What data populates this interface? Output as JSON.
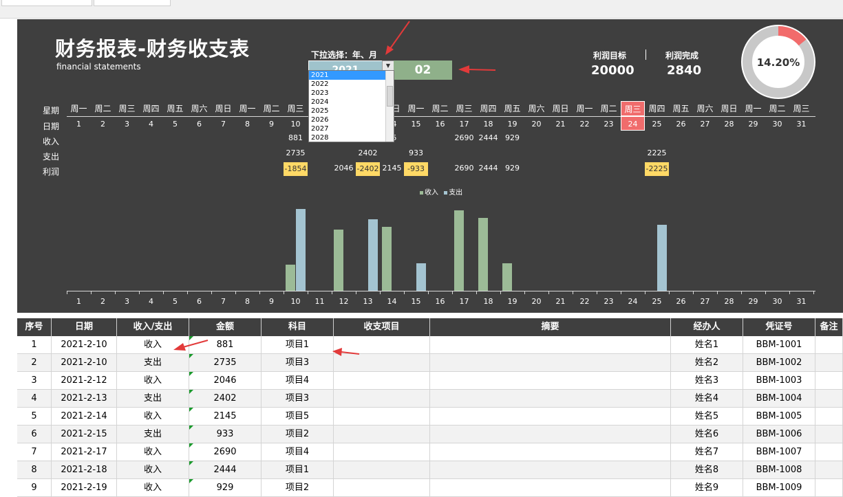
{
  "header": {
    "title": "财务报表-财务收支表",
    "subtitle": "financial statements"
  },
  "selector": {
    "label": "下拉选择：年、月",
    "year": "2021",
    "month": "02",
    "year_options": [
      "2021",
      "2022",
      "2023",
      "2024",
      "2025",
      "2026",
      "2027",
      "2028"
    ]
  },
  "kpi": {
    "target_label": "利润目标",
    "target_value": "20000",
    "done_label": "利润完成",
    "done_value": "2840",
    "percent": "14.20%",
    "percent_value": 0.142
  },
  "calendar": {
    "row_labels": [
      "星期",
      "日期",
      "收入",
      "支出",
      "利润"
    ],
    "weekdays": [
      "周一",
      "周二",
      "周三",
      "周四",
      "周五",
      "周六",
      "周日",
      "周一",
      "周二",
      "周三",
      "周四",
      "周五",
      "周六",
      "周日",
      "周一",
      "周二",
      "周三",
      "周四",
      "周五",
      "周六",
      "周日",
      "周一",
      "周二",
      "周三",
      "周四",
      "周五",
      "周六",
      "周日",
      "周一",
      "周二",
      "周三"
    ],
    "dates": [
      "1",
      "2",
      "3",
      "4",
      "5",
      "6",
      "7",
      "8",
      "9",
      "10",
      "11",
      "12",
      "13",
      "14",
      "15",
      "16",
      "17",
      "18",
      "19",
      "20",
      "21",
      "22",
      "23",
      "24",
      "25",
      "26",
      "27",
      "28",
      "29",
      "30",
      "31"
    ],
    "highlight_index": 23,
    "income": [
      "",
      "",
      "",
      "",
      "",
      "",
      "",
      "",
      "",
      "881",
      "",
      "",
      "",
      "45",
      "",
      "",
      "2690",
      "2444",
      "929",
      "",
      "",
      "",
      "",
      "",
      "",
      "",
      "",
      "",
      "",
      "",
      ""
    ],
    "expense": [
      "",
      "",
      "",
      "",
      "",
      "",
      "",
      "",
      "",
      "2735",
      "",
      "",
      "2402",
      "",
      "933",
      "",
      "",
      "",
      "",
      "",
      "",
      "",
      "",
      "",
      "2225",
      "",
      "",
      "",
      "",
      "",
      ""
    ],
    "profit": [
      "",
      "",
      "",
      "",
      "",
      "",
      "",
      "",
      "",
      "-1854",
      "",
      "2046",
      "-2402",
      "2145",
      "-933",
      "",
      "2690",
      "2444",
      "929",
      "",
      "",
      "",
      "",
      "",
      "-2225",
      "",
      "",
      "",
      "",
      "",
      ""
    ]
  },
  "chart_data": {
    "type": "bar",
    "legend": [
      "收入",
      "支出"
    ],
    "legend_position": "top",
    "categories": [
      "1",
      "2",
      "3",
      "4",
      "5",
      "6",
      "7",
      "8",
      "9",
      "10",
      "11",
      "12",
      "13",
      "14",
      "15",
      "16",
      "17",
      "18",
      "19",
      "20",
      "21",
      "22",
      "23",
      "24",
      "25",
      "26",
      "27",
      "28",
      "29",
      "30",
      "31"
    ],
    "series": [
      {
        "name": "收入",
        "color": "#9cbb97",
        "values": [
          0,
          0,
          0,
          0,
          0,
          0,
          0,
          0,
          0,
          881,
          0,
          2046,
          0,
          2145,
          0,
          0,
          2690,
          2444,
          929,
          0,
          0,
          0,
          0,
          0,
          0,
          0,
          0,
          0,
          0,
          0,
          0
        ]
      },
      {
        "name": "支出",
        "color": "#a4c4d1",
        "values": [
          0,
          0,
          0,
          0,
          0,
          0,
          0,
          0,
          0,
          2735,
          0,
          0,
          2402,
          0,
          933,
          0,
          0,
          0,
          0,
          0,
          0,
          0,
          0,
          0,
          2225,
          0,
          0,
          0,
          0,
          0,
          0
        ]
      }
    ],
    "ylim": [
      0,
      3000
    ]
  },
  "table": {
    "headers": [
      "序号",
      "日期",
      "收入/支出",
      "金额",
      "科目",
      "收支项目",
      "摘要",
      "经办人",
      "凭证号",
      "备注"
    ],
    "rows": [
      [
        "1",
        "2021-2-10",
        "收入",
        "881",
        "项目1",
        "",
        "",
        "姓名1",
        "BBM-1001",
        ""
      ],
      [
        "2",
        "2021-2-10",
        "支出",
        "2735",
        "项目3",
        "",
        "",
        "姓名2",
        "BBM-1002",
        ""
      ],
      [
        "3",
        "2021-2-12",
        "收入",
        "2046",
        "项目4",
        "",
        "",
        "姓名3",
        "BBM-1003",
        ""
      ],
      [
        "4",
        "2021-2-13",
        "支出",
        "2402",
        "项目3",
        "",
        "",
        "姓名4",
        "BBM-1004",
        ""
      ],
      [
        "5",
        "2021-2-14",
        "收入",
        "2145",
        "项目5",
        "",
        "",
        "姓名5",
        "BBM-1005",
        ""
      ],
      [
        "6",
        "2021-2-15",
        "支出",
        "933",
        "项目2",
        "",
        "",
        "姓名6",
        "BBM-1006",
        ""
      ],
      [
        "7",
        "2021-2-17",
        "收入",
        "2690",
        "项目4",
        "",
        "",
        "姓名7",
        "BBM-1007",
        ""
      ],
      [
        "8",
        "2021-2-18",
        "收入",
        "2444",
        "项目1",
        "",
        "",
        "姓名8",
        "BBM-1008",
        ""
      ],
      [
        "9",
        "2021-2-19",
        "收入",
        "929",
        "项目2",
        "",
        "",
        "姓名9",
        "BBM-1009",
        ""
      ]
    ]
  },
  "colors": {
    "panel": "#3f3f3f",
    "income": "#9cbb97",
    "expense": "#a4c4d1",
    "highlight": "#f06c6c",
    "negative": "#ffd966",
    "donut_fill": "#f26b6b",
    "donut_track": "#c8c8c8",
    "arrow": "#e23a3a"
  }
}
